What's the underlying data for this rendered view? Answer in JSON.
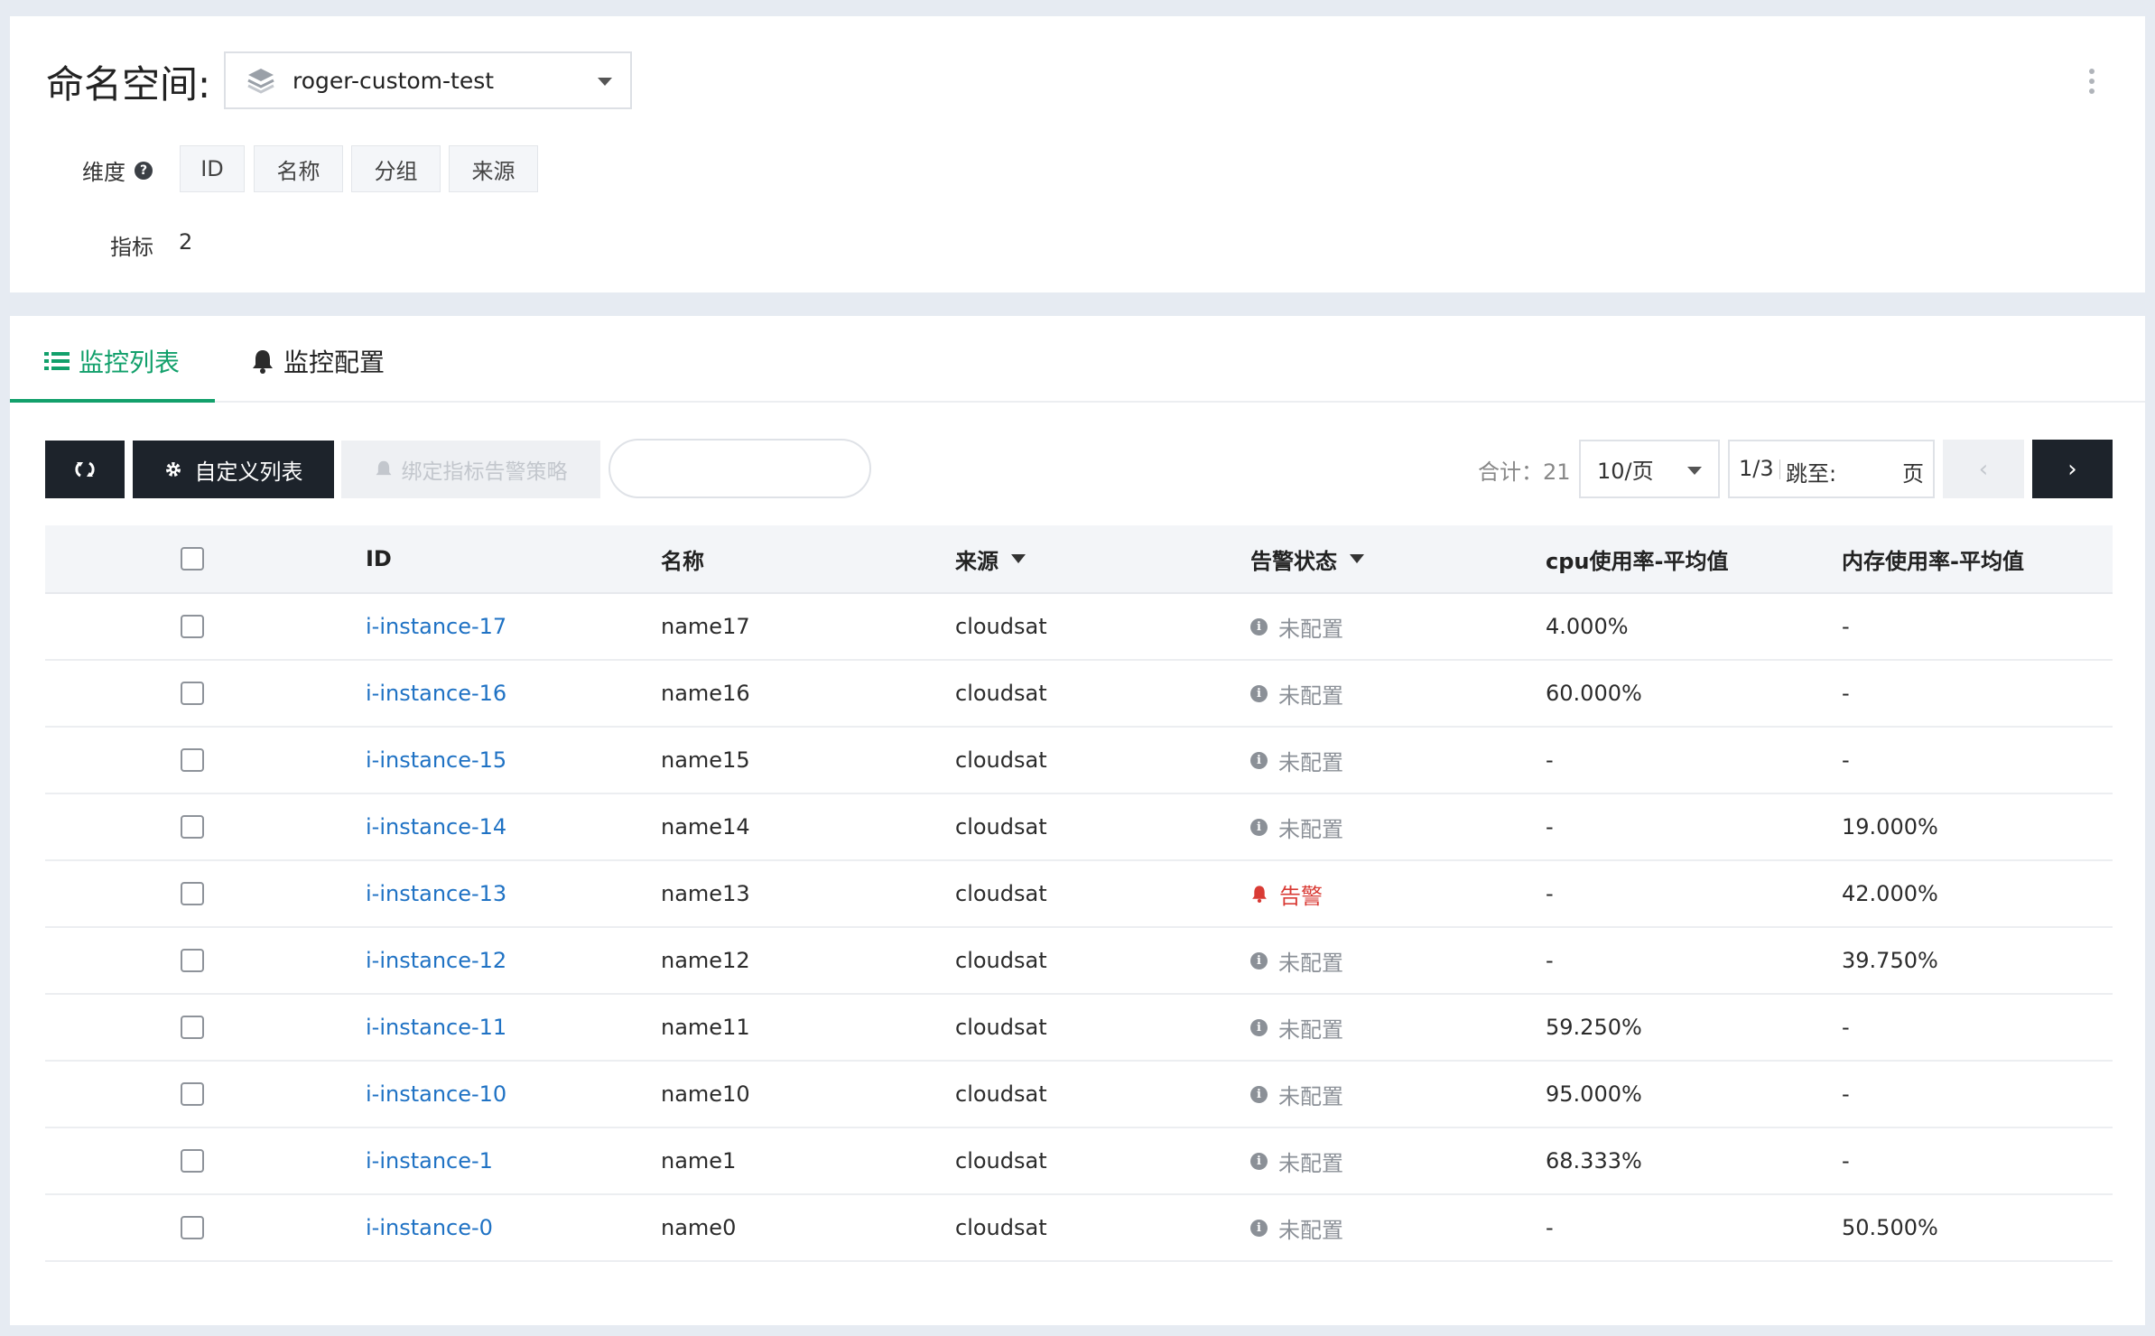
{
  "namespace": {
    "label": "命名空间:",
    "selected": "roger-custom-test"
  },
  "dimensions": {
    "label": "维度",
    "tags": [
      "ID",
      "名称",
      "分组",
      "来源"
    ]
  },
  "metrics": {
    "label": "指标",
    "value": "2"
  },
  "tabs": [
    {
      "label": "监控列表",
      "icon": "list-icon",
      "active": true
    },
    {
      "label": "监控配置",
      "icon": "bell-icon",
      "active": false
    }
  ],
  "toolbar": {
    "refresh_icon": "refresh-icon",
    "customize_label": "自定义列表",
    "bind_label": "绑定指标告警策略",
    "search_placeholder": ""
  },
  "pagination": {
    "total": "合计：21",
    "page_size": "10/页",
    "page": "1/3",
    "jump_label": "跳至:",
    "jump_suffix": "页",
    "prev": "‹",
    "next": "›"
  },
  "table": {
    "headers": {
      "id": "ID",
      "name": "名称",
      "source": "来源",
      "alarm": "告警状态",
      "cpu": "cpu使用率-平均值",
      "mem": "内存使用率-平均值"
    },
    "rows": [
      {
        "id": "i-instance-17",
        "name": "name17",
        "source": "cloudsat",
        "alarm": "未配置",
        "alarm_type": "none",
        "cpu": "4.000%",
        "mem": "-"
      },
      {
        "id": "i-instance-16",
        "name": "name16",
        "source": "cloudsat",
        "alarm": "未配置",
        "alarm_type": "none",
        "cpu": "60.000%",
        "mem": "-"
      },
      {
        "id": "i-instance-15",
        "name": "name15",
        "source": "cloudsat",
        "alarm": "未配置",
        "alarm_type": "none",
        "cpu": "-",
        "mem": "-"
      },
      {
        "id": "i-instance-14",
        "name": "name14",
        "source": "cloudsat",
        "alarm": "未配置",
        "alarm_type": "none",
        "cpu": "-",
        "mem": "19.000%"
      },
      {
        "id": "i-instance-13",
        "name": "name13",
        "source": "cloudsat",
        "alarm": "告警",
        "alarm_type": "alarm",
        "cpu": "-",
        "mem": "42.000%"
      },
      {
        "id": "i-instance-12",
        "name": "name12",
        "source": "cloudsat",
        "alarm": "未配置",
        "alarm_type": "none",
        "cpu": "-",
        "mem": "39.750%"
      },
      {
        "id": "i-instance-11",
        "name": "name11",
        "source": "cloudsat",
        "alarm": "未配置",
        "alarm_type": "none",
        "cpu": "59.250%",
        "mem": "-"
      },
      {
        "id": "i-instance-10",
        "name": "name10",
        "source": "cloudsat",
        "alarm": "未配置",
        "alarm_type": "none",
        "cpu": "95.000%",
        "mem": "-"
      },
      {
        "id": "i-instance-1",
        "name": "name1",
        "source": "cloudsat",
        "alarm": "未配置",
        "alarm_type": "none",
        "cpu": "68.333%",
        "mem": "-"
      },
      {
        "id": "i-instance-0",
        "name": "name0",
        "source": "cloudsat",
        "alarm": "未配置",
        "alarm_type": "none",
        "cpu": "-",
        "mem": "50.500%"
      }
    ]
  },
  "colors": {
    "accent": "#12a06b",
    "link": "#1f72c4",
    "alarm": "#d93b35",
    "dark_button": "#1d232b"
  }
}
